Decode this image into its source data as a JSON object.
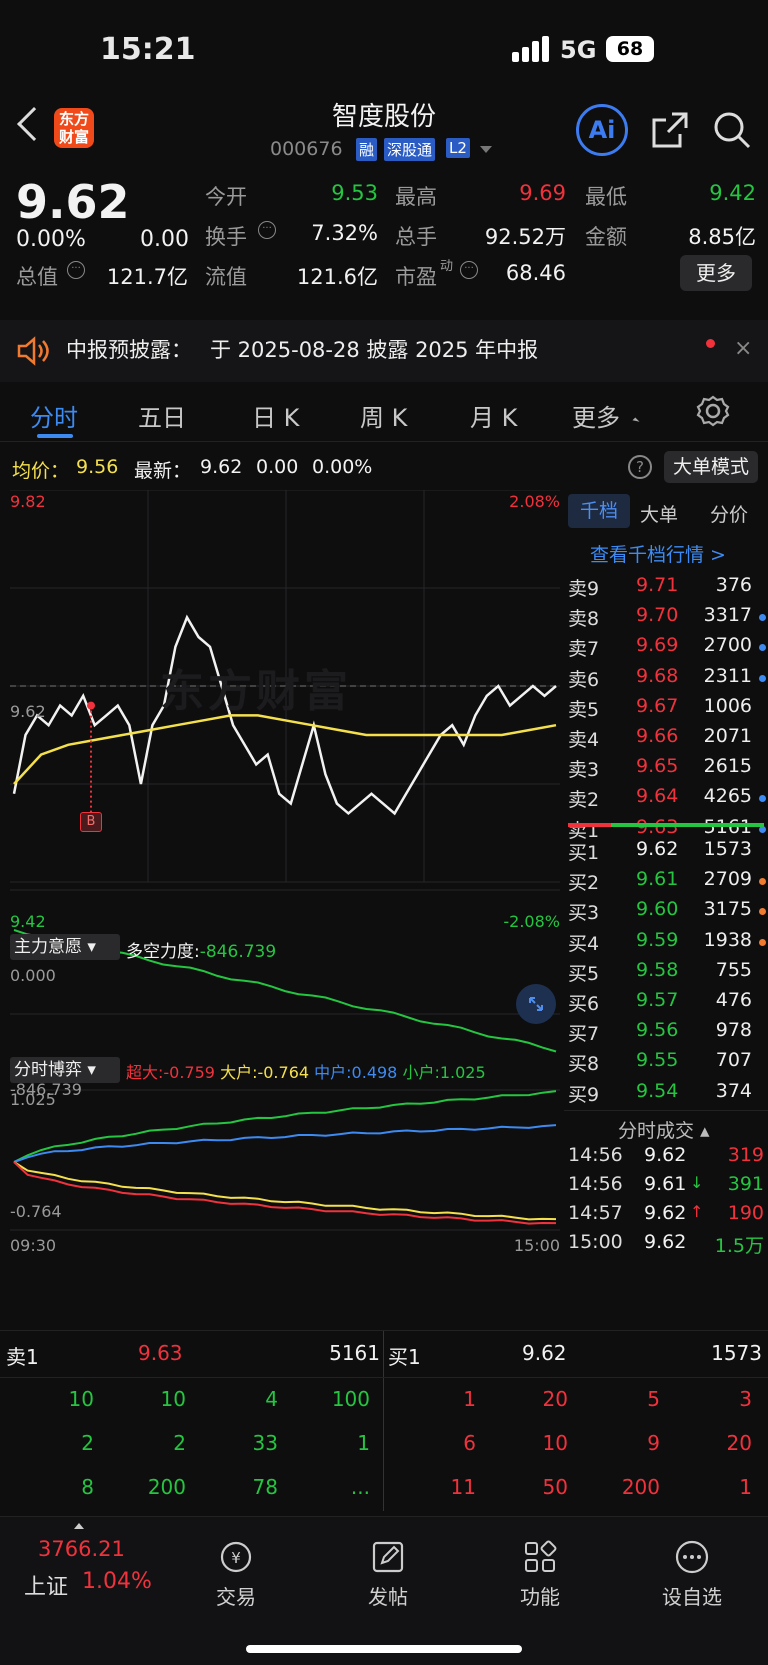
{
  "status": {
    "time": "15:21",
    "network": "5G",
    "battery": "68"
  },
  "header": {
    "title": "智度股份",
    "code": "000676",
    "tags": [
      "融",
      "深股通",
      "L2"
    ],
    "logo_line1": "东方",
    "logo_line2": "财富",
    "ai_label": "Ai"
  },
  "quote": {
    "price": "9.62",
    "change_pct": "0.00%",
    "change": "0.00",
    "open_label": "今开",
    "open": "9.53",
    "high_label": "最高",
    "high": "9.69",
    "low_label": "最低",
    "low": "9.42",
    "turnover_label": "换手",
    "turnover": "7.32%",
    "volume_label": "总手",
    "volume": "92.52万",
    "amount_label": "金额",
    "amount": "8.85亿",
    "mktcap_label": "总值",
    "mktcap": "121.7亿",
    "float_label": "流值",
    "float": "121.6亿",
    "pe_label": "市盈",
    "pe_sup": "动",
    "pe": "68.46",
    "more": "更多"
  },
  "notice": {
    "label": "中报预披露：",
    "text": "于 2025-08-28 披露 2025 年中报"
  },
  "tabs": [
    "分时",
    "五日",
    "日 K",
    "周 K",
    "月 K",
    "更多"
  ],
  "avg": {
    "avg_label": "均价：",
    "avg": "9.56",
    "latest_label": "最新：",
    "latest": "9.62",
    "chg": "0.00",
    "pct": "0.00%",
    "bigorder": "大单模式"
  },
  "chart": {
    "top_price": "9.82",
    "bottom_price": "9.42",
    "top_pct": "2.08%",
    "bottom_pct": "-2.08%",
    "mid_price": "9.62",
    "watermark": "东方财富",
    "marker": "B",
    "ind1_title": "主力意愿",
    "ind1_label": "多空力度:",
    "ind1_value": "-846.739",
    "ind1_max": "0.000",
    "ind1_min": "-846.739",
    "ind2_title": "分时博弈",
    "ind2_s1": "超大:-0.759",
    "ind2_s2": "大户:-0.764",
    "ind2_s3": "中户:0.498",
    "ind2_s4": "小户:1.025",
    "ind2_max": "1.025",
    "ind2_min": "-0.764",
    "t_start": "09:30",
    "t_end": "15:00"
  },
  "chart_data": {
    "type": "line",
    "title": "",
    "x_range": [
      "09:30",
      "15:00"
    ],
    "ylim": [
      9.42,
      9.82
    ],
    "prev_close": 9.62,
    "series": [
      {
        "name": "最新",
        "values": [
          9.51,
          9.57,
          9.59,
          9.58,
          9.6,
          9.59,
          9.61,
          9.58,
          9.59,
          9.6,
          9.58,
          9.52,
          9.58,
          9.6,
          9.66,
          9.69,
          9.67,
          9.66,
          9.62,
          9.58,
          9.56,
          9.54,
          9.55,
          9.51,
          9.5,
          9.54,
          9.58,
          9.53,
          9.5,
          9.49,
          9.5,
          9.51,
          9.5,
          9.49,
          9.51,
          9.53,
          9.55,
          9.57,
          9.58,
          9.56,
          9.59,
          9.61,
          9.62,
          9.6,
          9.61,
          9.62,
          9.61,
          9.62
        ]
      },
      {
        "name": "均价",
        "values": [
          9.52,
          9.55,
          9.56,
          9.565,
          9.57,
          9.575,
          9.58,
          9.585,
          9.59,
          9.59,
          9.585,
          9.58,
          9.575,
          9.57,
          9.57,
          9.57,
          9.57,
          9.57,
          9.57,
          9.575,
          9.58
        ]
      }
    ]
  },
  "tabs_book": [
    "千档",
    "大单",
    "分价"
  ],
  "book_link": "查看千档行情 >",
  "asks": [
    [
      "卖9",
      "9.71",
      "376",
      ""
    ],
    [
      "卖8",
      "9.70",
      "3317",
      "b"
    ],
    [
      "卖7",
      "9.69",
      "2700",
      "b"
    ],
    [
      "卖6",
      "9.68",
      "2311",
      "b"
    ],
    [
      "卖5",
      "9.67",
      "1006",
      ""
    ],
    [
      "卖4",
      "9.66",
      "2071",
      ""
    ],
    [
      "卖3",
      "9.65",
      "2615",
      ""
    ],
    [
      "卖2",
      "9.64",
      "4265",
      "b"
    ],
    [
      "卖1",
      "9.63",
      "5161",
      "b"
    ]
  ],
  "bids": [
    [
      "买1",
      "9.62",
      "1573",
      ""
    ],
    [
      "买2",
      "9.61",
      "2709",
      "o"
    ],
    [
      "买3",
      "9.60",
      "3175",
      "o"
    ],
    [
      "买4",
      "9.59",
      "1938",
      "o"
    ],
    [
      "买5",
      "9.58",
      "755",
      ""
    ],
    [
      "买6",
      "9.57",
      "476",
      ""
    ],
    [
      "买7",
      "9.56",
      "978",
      ""
    ],
    [
      "买8",
      "9.55",
      "707",
      ""
    ],
    [
      "买9",
      "9.54",
      "374",
      ""
    ]
  ],
  "trades_title": "分时成交",
  "trades": [
    [
      "14:56",
      "9.62",
      "",
      "319",
      "red"
    ],
    [
      "14:56",
      "9.61",
      "↓",
      "391",
      "grn"
    ],
    [
      "14:57",
      "9.62",
      "↑",
      "190",
      "red"
    ],
    [
      "15:00",
      "9.62",
      "",
      "1.5万",
      "grn"
    ]
  ],
  "l1": {
    "ask_label": "卖1",
    "ask_price": "9.63",
    "ask_vol": "5161",
    "bid_label": "买1",
    "bid_price": "9.62",
    "bid_vol": "1573",
    "ask_queue": [
      "10",
      "10",
      "4",
      "100",
      "2",
      "2",
      "33",
      "1",
      "8",
      "200",
      "78",
      "..."
    ],
    "bid_queue": [
      "1",
      "20",
      "5",
      "3",
      "6",
      "10",
      "9",
      "20",
      "11",
      "50",
      "200",
      "1"
    ]
  },
  "bottom": {
    "index_value": "3766.21",
    "index_name": "上证",
    "index_pct": "1.04%",
    "items": [
      "交易",
      "发帖",
      "功能",
      "设自选"
    ]
  }
}
